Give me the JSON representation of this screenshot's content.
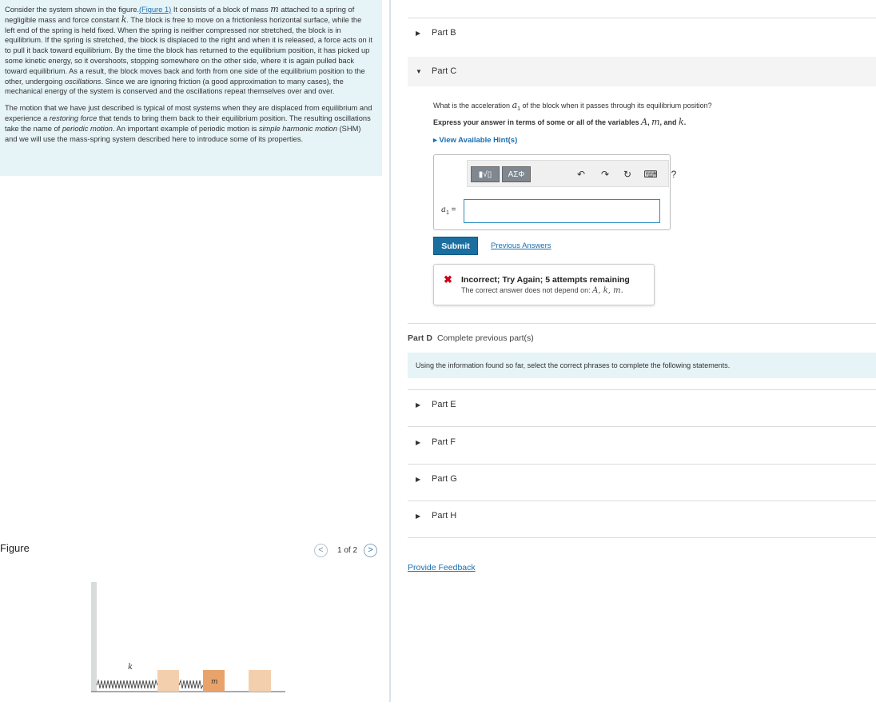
{
  "intro": {
    "p1_prefix": "Consider the system shown in the figure.",
    "figure_link": "(Figure 1)",
    "p1_a": " It consists of a block of mass ",
    "var_m": "m",
    "p1_b": " attached to a spring of negligible mass and force constant ",
    "var_k": "k",
    "p1_c": ". The block is free to move on a frictionless horizontal surface, while the left end of the spring is held fixed. When the spring is neither compressed nor stretched, the block is in equilibrium. If the spring is stretched, the block is displaced to the right and when it is released, a force acts on it to pull it back toward equilibrium. By the time the block has returned to the equilibrium position, it has picked up some kinetic energy, so it overshoots, stopping somewhere on the other side, where it is again pulled back toward equilibrium. As a result, the block moves back and forth from one side of the equilibrium position to the other, undergoing ",
    "oscillations": "oscillations",
    "p1_d": ". Since we are ignoring friction (a good approximation to many cases), the mechanical energy of the system is conserved and the oscillations repeat themselves over and over.",
    "p2_a": "The motion that we have just described is typical of most systems when they are displaced from equilibrium and experience a ",
    "restoring_force": "restoring force",
    "p2_b": " that tends to bring them back to their equilibrium position. The resulting oscillations take the name of ",
    "periodic_motion": "periodic motion",
    "p2_c": ". An important example of periodic motion is ",
    "shm": "simple harmonic motion",
    "p2_d": " (SHM) and we will use the mass-spring system described here to introduce some of its properties."
  },
  "figure": {
    "title": "Figure",
    "pager_text": "1 of 2",
    "prev_glyph": "<",
    "next_glyph": ">",
    "spring_label": "k",
    "mass_label": "m"
  },
  "parts": {
    "part_b": "Part B",
    "part_c": "Part C",
    "part_e": "Part E",
    "part_f": "Part F",
    "part_g": "Part G",
    "part_h": "Part H",
    "collapsed_glyph": "▶",
    "expanded_glyph": "▼"
  },
  "part_c": {
    "question_a": "What is the acceleration ",
    "question_var": "a",
    "question_sub": "1",
    "question_b": " of the block when it passes through its equilibrium position?",
    "express_a": "Express your answer in terms of some or all of the variables ",
    "express_vars_1": "A",
    "express_sep": ", ",
    "express_vars_2": "m",
    "express_and": ", and ",
    "express_vars_3": "k",
    "express_end": ".",
    "hint_label": "▸  View Available Hint(s)",
    "toolbar": {
      "template": "▮√▯",
      "greek": "ΑΣΦ",
      "undo": "↶",
      "redo": "↷",
      "reset": "↻",
      "keyboard": "⌨",
      "help": "?"
    },
    "answer_label_var": "a",
    "answer_label_sub": "1",
    "answer_label_eq": " =",
    "answer_value": "",
    "submit_label": "Submit",
    "previous_answers": "Previous Answers",
    "feedback_icon": "✖",
    "feedback_title": "Incorrect; Try Again; 5 attempts remaining",
    "feedback_sub": "The correct answer does not depend on: ",
    "feedback_vars": "A, k, m."
  },
  "part_d": {
    "label": "Part D",
    "status": "Complete previous part(s)"
  },
  "info_bar": "Using the information found so far, select the correct phrases to complete the following statements.",
  "provide_feedback": "Provide Feedback"
}
